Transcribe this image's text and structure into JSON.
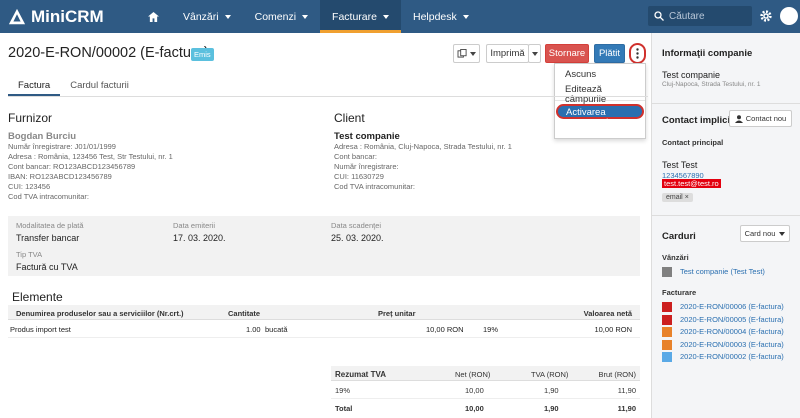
{
  "app": {
    "name": "MiniCRM"
  },
  "nav": {
    "items": [
      {
        "label": "Vânzări"
      },
      {
        "label": "Comenzi"
      },
      {
        "label": "Facturare"
      },
      {
        "label": "Helpdesk"
      }
    ]
  },
  "search": {
    "placeholder": "Căutare"
  },
  "doc": {
    "title": "2020-E-RON/00002 (E-factura)",
    "status": "Emis"
  },
  "toolbar": {
    "print": "Imprimă",
    "storno": "Stornare",
    "paid": "Plătit"
  },
  "menu": {
    "items": [
      "Ascuns",
      "Editează câmpurile",
      "Activarea recurenţei"
    ]
  },
  "tabs": [
    "Factura",
    "Cardul facturii"
  ],
  "supplier": {
    "heading": "Furnizor",
    "name": "Bogdan Burciu",
    "lines": [
      "Număr înregistrare: J01/01/1999",
      "Adresa : România, 123456 Test, Str Testului, nr. 1",
      "Cont bancar: RO123ABCD123456789",
      "IBAN: RO123ABCD123456789",
      "CUI: 123456",
      "Cod TVA intracomunitar:"
    ]
  },
  "client": {
    "heading": "Client",
    "name": "Test companie",
    "lines": [
      "Adresa : România, Cluj-Napoca, Strada Testului, nr. 1",
      "Cont bancar:",
      "Număr înregistrare:",
      "CUI: 11630729",
      "Cod TVA intracomunitar:"
    ]
  },
  "payment": {
    "label": "Modalitatea de plată",
    "value": "Transfer bancar"
  },
  "issue_date": {
    "label": "Data emiterii",
    "value": "17. 03. 2020."
  },
  "due_date": {
    "label": "Data scadenţei",
    "value": "25. 03. 2020."
  },
  "vat_type": {
    "label": "Tip TVA",
    "value": "Factură cu TVA"
  },
  "items": {
    "heading": "Elemente",
    "columns": [
      "Denumirea produselor sau a serviciilor (Nr.crt.)",
      "Cantitate",
      "Preț unitar",
      "Valoarea netă"
    ],
    "rows": [
      {
        "name": "Produs import test",
        "qty": "1.00",
        "unit": "bucată",
        "price": "10,00 RON",
        "vat": "19%",
        "net": "10,00 RON"
      }
    ]
  },
  "vat_summary": {
    "columns": [
      "Rezumat TVA",
      "Net (RON)",
      "TVA (RON)",
      "Brut (RON)"
    ],
    "rows": [
      [
        "19%",
        "10,00",
        "1,90",
        "11,90"
      ],
      [
        "Total",
        "10,00",
        "1,90",
        "11,90"
      ]
    ]
  },
  "company_info": {
    "heading": "Informaţii companie",
    "name": "Test companie",
    "address": "Cluj-Napoca, Strada Testului, nr. 1"
  },
  "contact": {
    "heading": "Contact implicit",
    "new_btn": "Contact nou",
    "sub": "Contact principal",
    "name": "Test Test",
    "phone": "1234567890",
    "email": "test.test@test.ro",
    "tag": "email"
  },
  "cards": {
    "heading": "Carduri",
    "new_btn": "Card nou",
    "sales_label": "Vânzări",
    "sales_item": "Test companie (Test Test)",
    "billing_label": "Facturare",
    "invoices": [
      {
        "label": "2020-E-RON/00006 (E-factura)",
        "color": "#cc1f1f"
      },
      {
        "label": "2020-E-RON/00005 (E-factura)",
        "color": "#cc1f1f"
      },
      {
        "label": "2020-E-RON/00004 (E-factura)",
        "color": "#e8822a"
      },
      {
        "label": "2020-E-RON/00003 (E-factura)",
        "color": "#e8822a"
      },
      {
        "label": "2020-E-RON/00002 (E-factura)",
        "color": "#5aa9e6"
      }
    ]
  }
}
